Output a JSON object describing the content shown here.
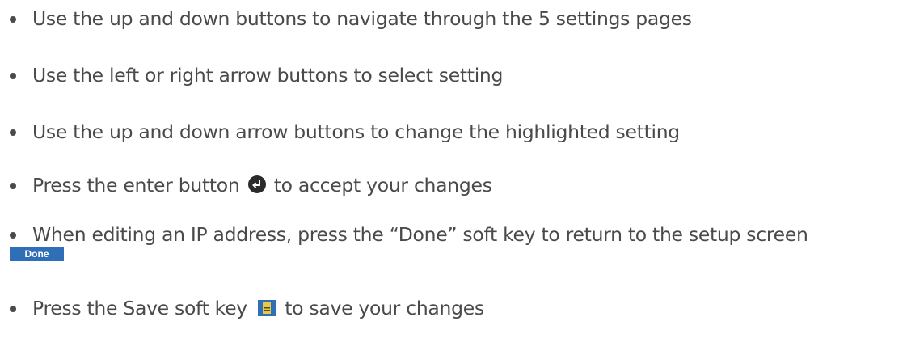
{
  "bullets": [
    {
      "text": "Use the up and down buttons to navigate through the 5 settings pages"
    },
    {
      "text": "Use the left or right arrow buttons to select setting"
    },
    {
      "text": "Use the up and down arrow buttons to change the highlighted setting"
    },
    {
      "text_before": "Press the enter button",
      "icon": "enter-icon",
      "text_after": "to accept your changes"
    },
    {
      "text": "When editing an IP address, press the “Done” soft key to return to the setup screen",
      "key_label": "Done"
    },
    {
      "text_before": "Press the Save soft key",
      "icon": "save-icon",
      "text_after": "to save your changes"
    }
  ],
  "colors": {
    "text": "#4a4a4a",
    "soft_key_blue": "#2f6fb8",
    "enter_icon": "#2b2b2b"
  }
}
